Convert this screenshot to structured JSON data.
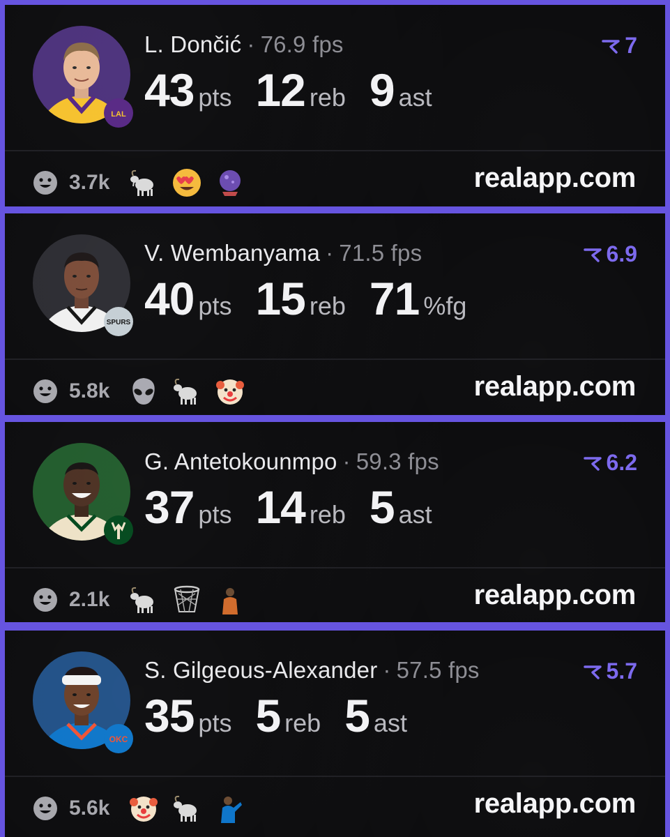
{
  "site": "realapp.com",
  "colors": {
    "accent": "#7b68ee",
    "frame": "#6654e0",
    "card": "#0a0a0c"
  },
  "cards": [
    {
      "name": "L. Dončić",
      "fps": "76.9 fps",
      "rank": "7",
      "stats": [
        {
          "value": "43",
          "unit": "pts"
        },
        {
          "value": "12",
          "unit": "reb"
        },
        {
          "value": "9",
          "unit": "ast"
        }
      ],
      "reactions_count": "3.7k",
      "emojis": [
        "goat-emoji",
        "heart-eyes-emoji",
        "crystal-ball-emoji"
      ],
      "team_logo": "lakers-logo",
      "jersey": "#f6c12b",
      "jersey_trim": "#552583",
      "bg": "#4a2f7a"
    },
    {
      "name": "V. Wembanyama",
      "fps": "71.5 fps",
      "rank": "6.9",
      "stats": [
        {
          "value": "40",
          "unit": "pts"
        },
        {
          "value": "15",
          "unit": "reb"
        },
        {
          "value": "71",
          "unit": "%fg"
        }
      ],
      "reactions_count": "5.8k",
      "emojis": [
        "alien-emoji",
        "goat-emoji",
        "clown-emoji"
      ],
      "team_logo": "spurs-logo",
      "jersey": "#f0f0f0",
      "jersey_trim": "#111111",
      "bg": "#2a2a30"
    },
    {
      "name": "G. Antetokounmpo",
      "fps": "59.3 fps",
      "rank": "6.2",
      "stats": [
        {
          "value": "37",
          "unit": "pts"
        },
        {
          "value": "14",
          "unit": "reb"
        },
        {
          "value": "5",
          "unit": "ast"
        }
      ],
      "reactions_count": "2.1k",
      "emojis": [
        "goat-emoji",
        "basketball-hoop-emoji",
        "player-emoji"
      ],
      "team_logo": "bucks-logo",
      "jersey": "#eee1c6",
      "jersey_trim": "#00471b",
      "bg": "#1f5a2a"
    },
    {
      "name": "S. Gilgeous-Alexander",
      "fps": "57.5 fps",
      "rank": "5.7",
      "stats": [
        {
          "value": "35",
          "unit": "pts"
        },
        {
          "value": "5",
          "unit": "reb"
        },
        {
          "value": "5",
          "unit": "ast"
        }
      ],
      "reactions_count": "5.6k",
      "emojis": [
        "clown-emoji",
        "goat-emoji",
        "player-emoji"
      ],
      "team_logo": "thunder-logo",
      "jersey": "#0b74c9",
      "jersey_trim": "#f05133",
      "bg": "#1f4f86"
    }
  ]
}
